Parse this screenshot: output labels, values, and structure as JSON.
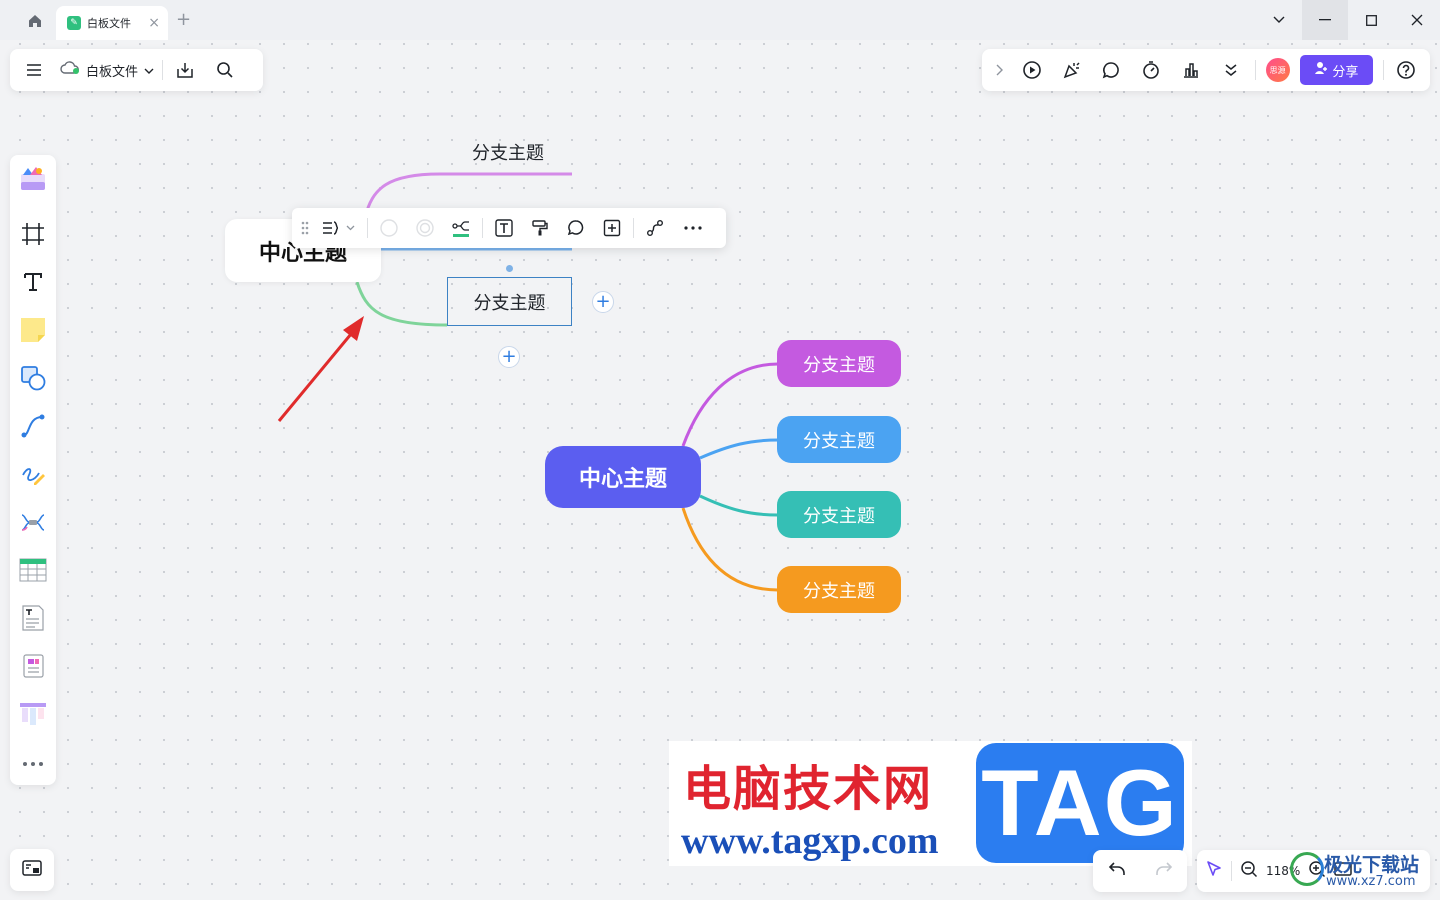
{
  "titlebar": {
    "tab_title": "白板文件",
    "tab_close": "×",
    "new_tab": "+"
  },
  "toolbar_left": {
    "doc_title": "白板文件"
  },
  "toolbar_right": {
    "avatar_text": "思源",
    "share_label": "分享"
  },
  "mindmap_1": {
    "center": "中心主题",
    "branch_top": "分支主题",
    "branch_selected": "分支主题"
  },
  "mindmap_2": {
    "center": "中心主题",
    "branches": [
      {
        "label": "分支主题",
        "color": "#c45ae0"
      },
      {
        "label": "分支主题",
        "color": "#4ba3f2"
      },
      {
        "label": "分支主题",
        "color": "#35bfb5"
      },
      {
        "label": "分支主题",
        "color": "#f59a1f"
      }
    ],
    "center_color": "#5b5ef0"
  },
  "zoom": {
    "value": "118%"
  },
  "watermark": {
    "cn": "电脑技术网",
    "url": "www.tagxp.com",
    "tag": "TAG",
    "site2_cn": "极光下载站",
    "site2_url": "www.xz7.com"
  },
  "colors": {
    "accent": "#6b4cf6",
    "arrow": "#e02b2b"
  }
}
